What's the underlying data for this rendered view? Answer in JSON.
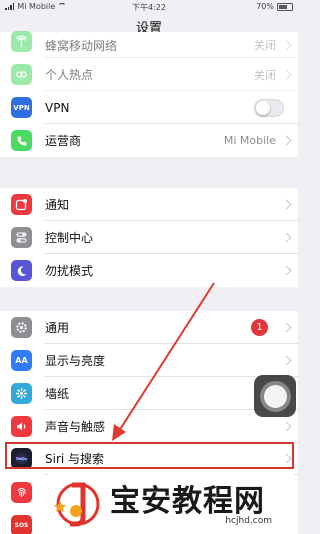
{
  "status_bar": {
    "carrier": "Mi Mobile",
    "time": "下午4:22",
    "battery": "70%"
  },
  "nav": {
    "title": "设置"
  },
  "group1": [
    {
      "label": "蜂窝移动网络",
      "value": "关闭",
      "icon": "antenna-icon",
      "color": "#4cd964"
    },
    {
      "label": "个人热点",
      "value": "关闭",
      "icon": "hotspot-icon",
      "color": "#4cd964"
    },
    {
      "label": "VPN",
      "value": "",
      "icon": "vpn-icon",
      "color": "#2f6ee0",
      "icon_text": "VPN",
      "toggle_on": false
    },
    {
      "label": "运营商",
      "value": "Mi Mobile",
      "icon": "phone-icon",
      "color": "#4cd964"
    }
  ],
  "group2": [
    {
      "label": "通知",
      "icon": "notifications-icon",
      "color": "#f0393e"
    },
    {
      "label": "控制中心",
      "icon": "control-center-icon",
      "color": "#8e8e93"
    },
    {
      "label": "勿扰模式",
      "icon": "moon-icon",
      "color": "#5856d6"
    }
  ],
  "group3": [
    {
      "label": "通用",
      "icon": "gear-icon",
      "color": "#8e8e93",
      "badge": "1"
    },
    {
      "label": "显示与亮度",
      "icon": "display-icon",
      "color": "#2f7cf6",
      "icon_text": "AA"
    },
    {
      "label": "墙纸",
      "icon": "wallpaper-icon",
      "color": "#34aadc"
    },
    {
      "label": "声音与触感",
      "icon": "speaker-icon",
      "color": "#f0393e"
    },
    {
      "label": "Siri 与搜索",
      "icon": "siri-icon",
      "color": "#1c1c2e"
    },
    {
      "label": "",
      "icon": "touch-id-icon",
      "color": "#f0393e"
    },
    {
      "label": "",
      "icon": "sos-icon",
      "color": "#e0342d",
      "icon_text": "SOS"
    }
  ],
  "watermark": {
    "title": "宝安教程网",
    "url": "hcjhd.com"
  }
}
